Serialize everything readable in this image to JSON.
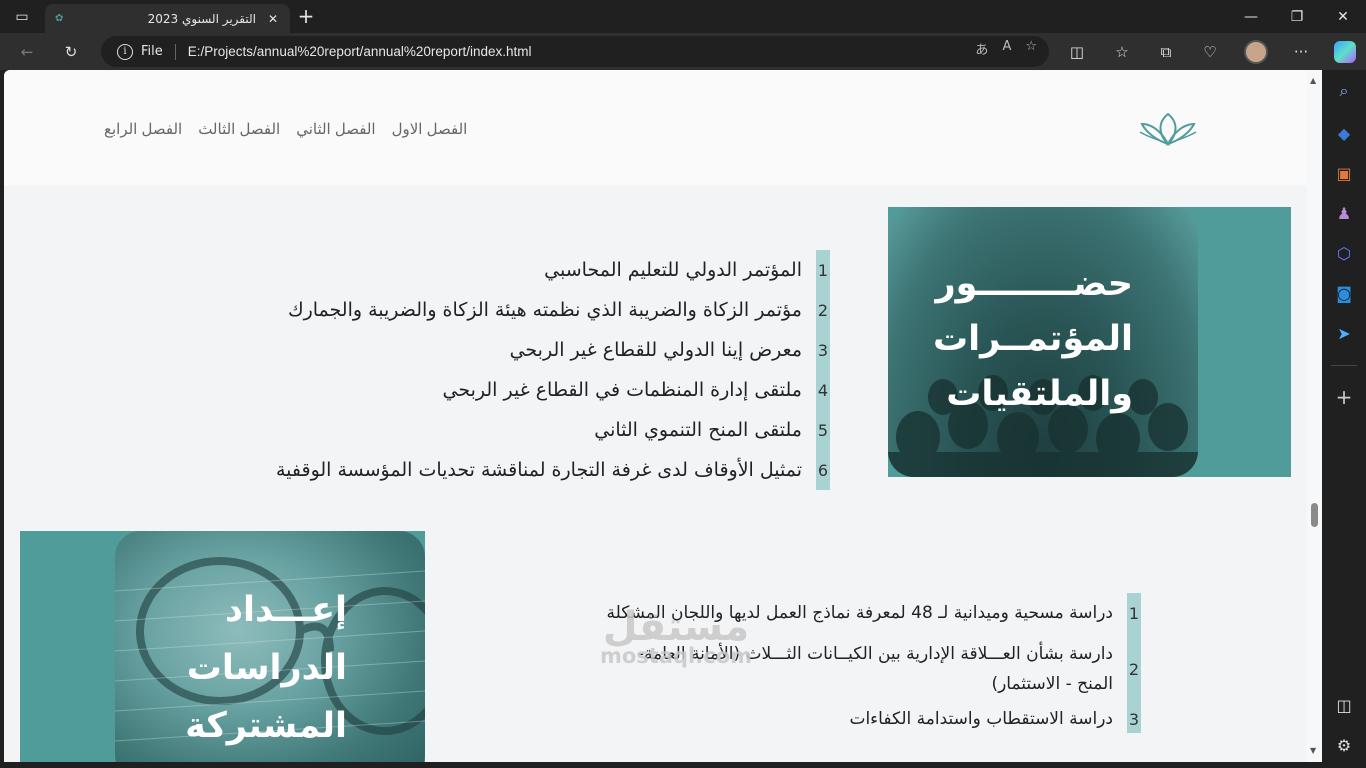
{
  "browser": {
    "tab_title": "التقرير السنوي 2023",
    "url_scheme": "File",
    "url": "E:/Projects/annual%20report/annual%20report/index.html"
  },
  "nav": {
    "items": [
      {
        "label": "الفصل الاول"
      },
      {
        "label": "الفصل الثاني"
      },
      {
        "label": "الفصل الثالث"
      },
      {
        "label": "الفصل الرابع"
      }
    ]
  },
  "section1": {
    "title_line1": "حضــــــــور",
    "title_line2": "المؤتمــرات",
    "title_line3": "والملتقيات",
    "items": [
      {
        "num": "1",
        "text": "المؤتمر الدولي للتعليم المحاسبي"
      },
      {
        "num": "2",
        "text": "مؤتمر الزكاة والضريبة الذي نظمته هيئة الزكاة والضريبة والجمارك"
      },
      {
        "num": "3",
        "text": "معرض إينا الدولي للقطاع غير الربحي"
      },
      {
        "num": "4",
        "text": "ملتقى إدارة المنظمات في القطاع غير الربحي"
      },
      {
        "num": "5",
        "text": "ملتقى المنح التنموي الثاني"
      },
      {
        "num": "6",
        "text": "تمثيل الأوقاف لدى غرفة التجارة لمناقشة تحديات المؤسسة الوقفية"
      }
    ]
  },
  "section2": {
    "title_line1": "إعـــداد",
    "title_line2": "الدراسات",
    "title_line3": "المشتركة",
    "items": [
      {
        "num": "1",
        "text": "دراسة مسحية وميدانية لـ 48 لمعرفة نماذج العمل لديها واللجان المشكلة"
      },
      {
        "num": "2",
        "text_line1": "دارسة بشأن العـــلاقة الإدارية بين الكيــانات الثـــلاث (الأمانة العامة-",
        "text_line2": "المنح - الاستثمار)"
      },
      {
        "num": "3",
        "text": "دراسة الاستقطاب واستدامة الكفاءات"
      }
    ]
  },
  "watermark": {
    "arabic": "مستقل",
    "latin": "mostaql.com"
  },
  "colors": {
    "teal": "#4f9c9b",
    "number_bar": "#a9d3d2"
  }
}
